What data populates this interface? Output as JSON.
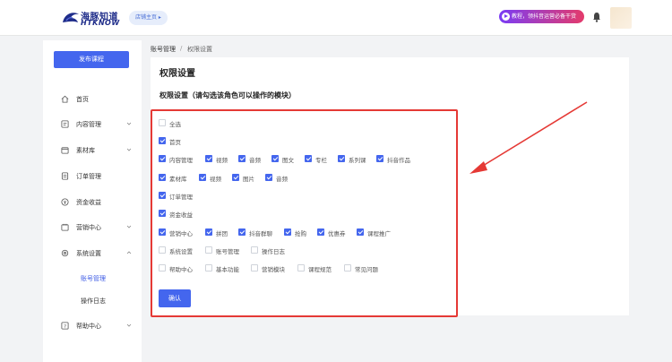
{
  "header": {
    "logo_cn": "海豚知道",
    "logo_en": "HTKNOW",
    "store_home": "店铺主页 ▸",
    "promo_text": "教程，领抖音运营必备干货",
    "colors": {
      "brand": "#1f2d8a",
      "accent": "#4466ee",
      "promo_start": "#7a3cf5",
      "promo_end": "#e43b6b"
    }
  },
  "sidebar": {
    "publish_label": "发布课程",
    "items": [
      {
        "label": "首页",
        "icon": "home-icon",
        "has_chevron": false
      },
      {
        "label": "内容管理",
        "icon": "content-icon",
        "has_chevron": true
      },
      {
        "label": "素材库",
        "icon": "material-icon",
        "has_chevron": true
      },
      {
        "label": "订单管理",
        "icon": "order-icon",
        "has_chevron": false
      },
      {
        "label": "资金收益",
        "icon": "money-icon",
        "has_chevron": false
      },
      {
        "label": "营销中心",
        "icon": "marketing-icon",
        "has_chevron": true
      },
      {
        "label": "系统设置",
        "icon": "settings-icon",
        "has_chevron": true
      },
      {
        "label": "帮助中心",
        "icon": "help-icon",
        "has_chevron": true
      }
    ],
    "subitems": [
      {
        "label": "账号管理",
        "active": true
      },
      {
        "label": "操作日志",
        "active": false
      }
    ]
  },
  "breadcrumb": {
    "parent": "账号管理",
    "separator": "/",
    "current": "权限设置"
  },
  "main": {
    "title": "权限设置",
    "section_title": "权限设置（请勾选该角色可以操作的模块）",
    "confirm_label": "确认"
  },
  "permissions": {
    "select_all": {
      "label": "全选",
      "checked": false
    },
    "rows": [
      [
        {
          "label": "首页",
          "checked": true
        }
      ],
      [
        {
          "label": "内容管理",
          "checked": true
        },
        {
          "label": "视频",
          "checked": true
        },
        {
          "label": "音频",
          "checked": true
        },
        {
          "label": "图文",
          "checked": true
        },
        {
          "label": "专栏",
          "checked": true
        },
        {
          "label": "系列课",
          "checked": true
        },
        {
          "label": "抖音作品",
          "checked": true
        }
      ],
      [
        {
          "label": "素材库",
          "checked": true
        },
        {
          "label": "视频",
          "checked": true
        },
        {
          "label": "图片",
          "checked": true
        },
        {
          "label": "音频",
          "checked": true
        }
      ],
      [
        {
          "label": "订单管理",
          "checked": true
        }
      ],
      [
        {
          "label": "资金收益",
          "checked": true
        }
      ],
      [
        {
          "label": "营销中心",
          "checked": true
        },
        {
          "label": "拼团",
          "checked": true
        },
        {
          "label": "抖音群聊",
          "checked": true
        },
        {
          "label": "抢购",
          "checked": true
        },
        {
          "label": "优惠券",
          "checked": true
        },
        {
          "label": "课程推广",
          "checked": true
        }
      ],
      [
        {
          "label": "系统设置",
          "checked": false
        },
        {
          "label": "账号管理",
          "checked": false
        },
        {
          "label": "操作日志",
          "checked": false
        }
      ],
      [
        {
          "label": "帮助中心",
          "checked": false
        },
        {
          "label": "基本功能",
          "checked": false
        },
        {
          "label": "营销模块",
          "checked": false
        },
        {
          "label": "课程规范",
          "checked": false
        },
        {
          "label": "常见问题",
          "checked": false
        }
      ]
    ]
  },
  "annotation": {
    "color": "#e53935"
  }
}
